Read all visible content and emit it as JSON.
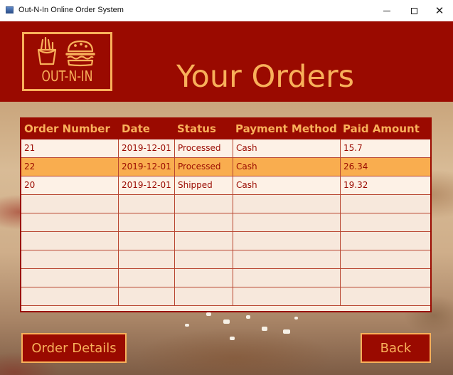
{
  "window": {
    "title": "Out-N-In Online Order System"
  },
  "header": {
    "logo_text": "OUT-N-IN",
    "title": "Your Orders"
  },
  "table": {
    "columns": [
      "Order Number",
      "Date",
      "Status",
      "Payment Method",
      "Paid Amount"
    ],
    "rows": [
      [
        "21",
        "2019-12-01",
        "Processed",
        "Cash",
        "15.7"
      ],
      [
        "22",
        "2019-12-01",
        "Processed",
        "Cash",
        "26.34"
      ],
      [
        "20",
        "2019-12-01",
        "Shipped",
        "Cash",
        "19.32"
      ]
    ],
    "selected_row": 1
  },
  "buttons": {
    "order_details": "Order Details",
    "back": "Back"
  },
  "colors": {
    "header_red": "#9a0a00",
    "accent_orange": "#f8b05a",
    "selected_row": "#f9ad4f"
  },
  "icons": [
    "app-window-icon",
    "fries-icon",
    "burger-icon"
  ]
}
